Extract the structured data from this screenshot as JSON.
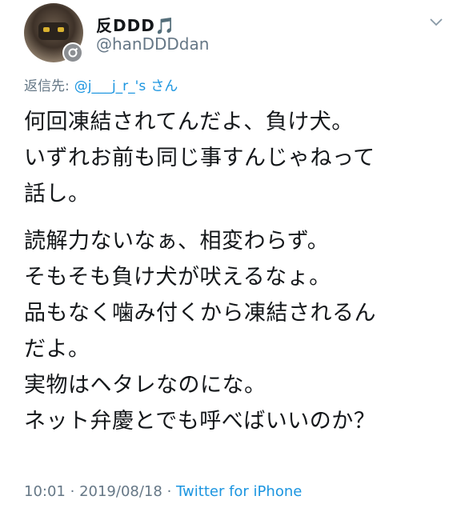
{
  "tweet": {
    "display_name": "反DDD🎵",
    "handle": "@hanDDDdan",
    "reply_label": "返信先:",
    "reply_mention": "@j___j_r_'s",
    "reply_suffix": "さん",
    "paragraphs": [
      {
        "lines": [
          "何回凍結されてんだよ、負け犬。",
          "いずれお前も同じ事すんじゃねって",
          "話し。"
        ]
      },
      {
        "lines": [
          "読解力ないなぁ、相変わらず。",
          "そもそも負け犬が吠えるなょ。",
          "品もなく噛み付くから凍結されるん",
          "だよ。",
          "実物はヘタレなのにな。",
          "ネット弁慶とでも呼べばいいのか？"
        ]
      }
    ],
    "time": "10:01",
    "separator": "·",
    "date": "2019/08/18",
    "source": "Twitter for iPhone"
  },
  "icons": {
    "menu": "chevron-down-icon",
    "badge": "reply-badge-icon"
  },
  "colors": {
    "text": "#14171a",
    "secondary": "#657786",
    "link": "#1b95e0"
  }
}
